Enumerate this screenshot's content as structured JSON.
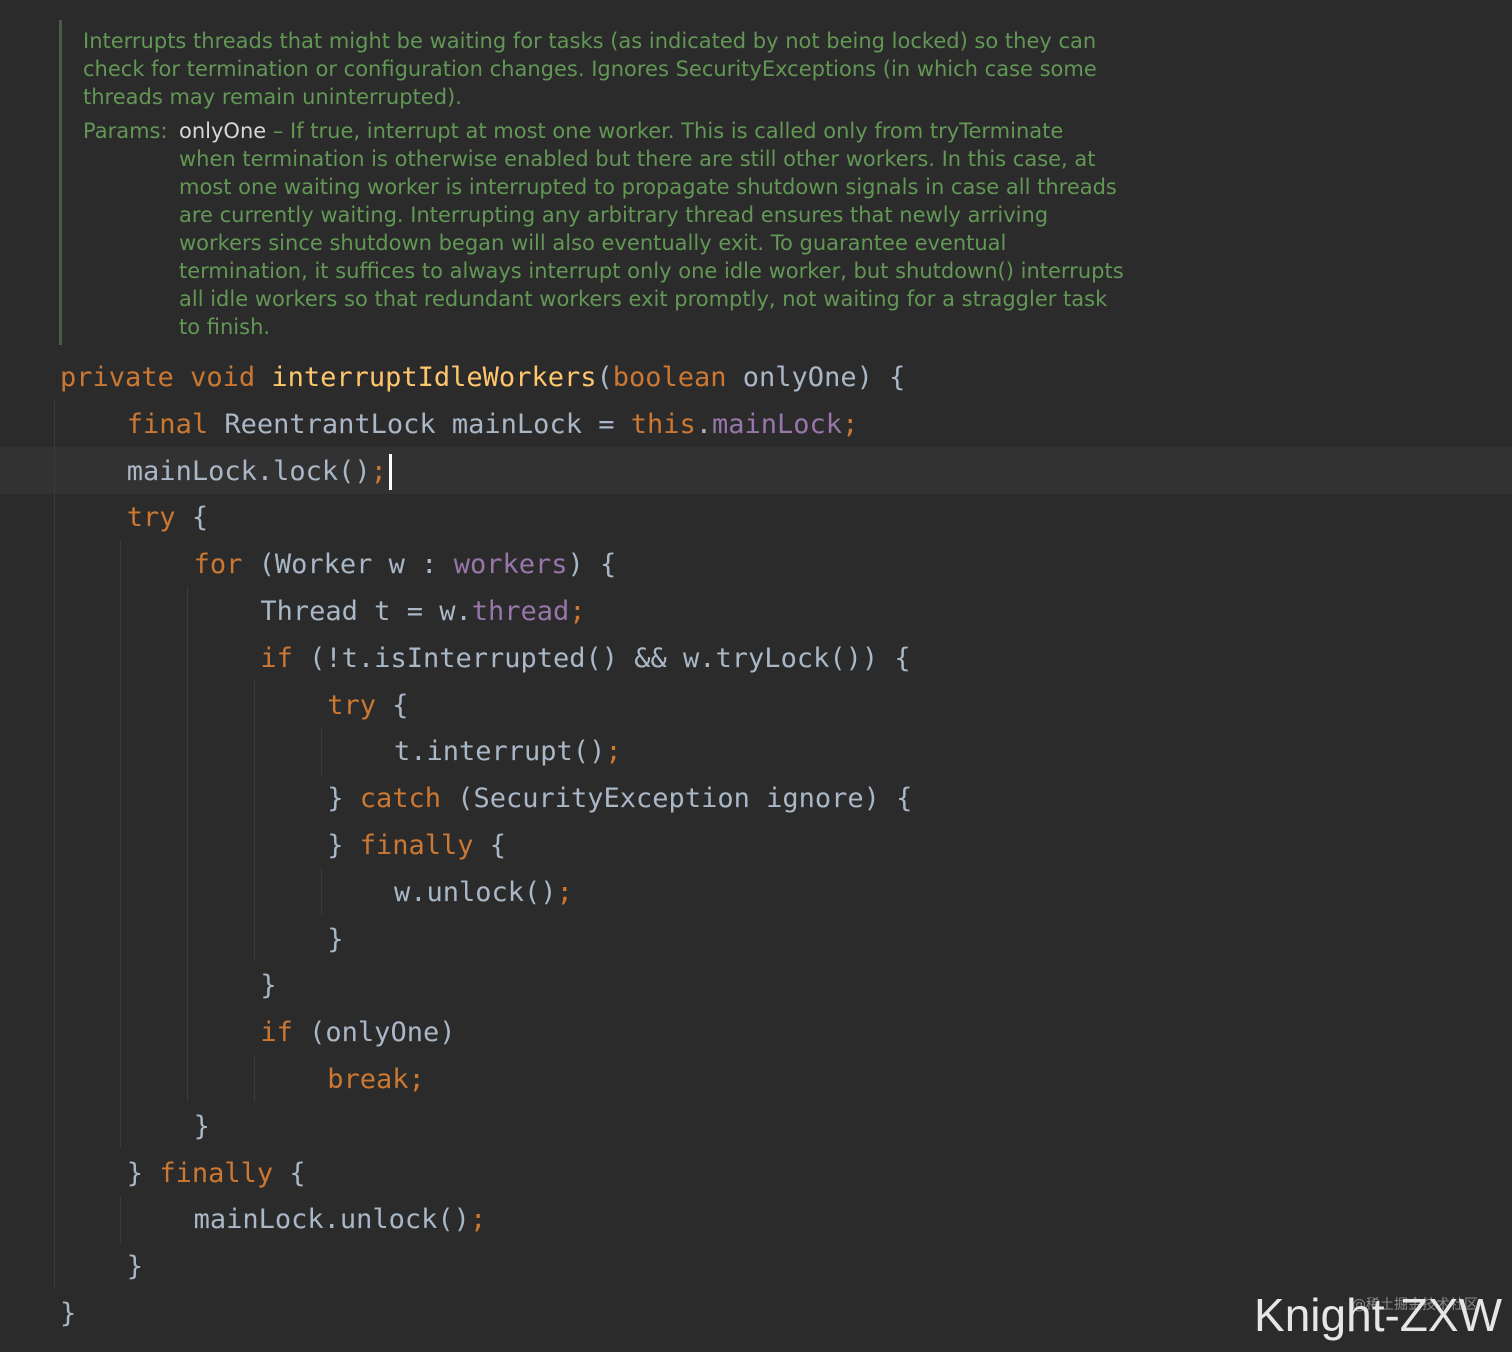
{
  "javadoc": {
    "summary": [
      "Interrupts threads that might be waiting for tasks (as indicated by not being locked) so they can",
      "check for termination or configuration changes. Ignores SecurityExceptions (in which case some",
      "threads may remain uninterrupted)."
    ],
    "params_label": "Params:",
    "param_name": "onlyOne",
    "param_desc": [
      " – If true, interrupt at most one worker. This is called only from tryTerminate",
      "when termination is otherwise enabled but there are still other workers. In this case, at",
      "most one waiting worker is interrupted to propagate shutdown signals in case all threads",
      "are currently waiting. Interrupting any arbitrary thread ensures that newly arriving",
      "workers since shutdown began will also eventually exit. To guarantee eventual",
      "termination, it suffices to always interrupt only one idle worker, but shutdown() interrupts",
      "all idle workers so that redundant workers exit promptly, not waiting for a straggler task",
      "to finish."
    ]
  },
  "code": [
    {
      "indent": 0,
      "tokens": [
        [
          "kw",
          "private"
        ],
        [
          "",
          " "
        ],
        [
          "kw",
          "void"
        ],
        [
          "",
          " "
        ],
        [
          "fn",
          "interruptIdleWorkers"
        ],
        [
          "",
          "("
        ],
        [
          "kw",
          "boolean"
        ],
        [
          "",
          " onlyOne) {"
        ]
      ]
    },
    {
      "indent": 1,
      "tokens": [
        [
          "kw",
          "final"
        ],
        [
          "",
          " ReentrantLock mainLock = "
        ],
        [
          "kw",
          "this"
        ],
        [
          "",
          "."
        ],
        [
          "fld",
          "mainLock"
        ],
        [
          "kw",
          ";"
        ]
      ]
    },
    {
      "indent": 1,
      "tokens": [
        [
          "",
          "mainLock.lock()"
        ],
        [
          "kw",
          ";"
        ]
      ],
      "caret": true
    },
    {
      "indent": 1,
      "tokens": [
        [
          "kw",
          "try"
        ],
        [
          "",
          " {"
        ]
      ]
    },
    {
      "indent": 2,
      "tokens": [
        [
          "kw",
          "for"
        ],
        [
          "",
          " (Worker w : "
        ],
        [
          "fld",
          "workers"
        ],
        [
          "",
          ") {"
        ]
      ]
    },
    {
      "indent": 3,
      "tokens": [
        [
          "",
          "Thread t = w."
        ],
        [
          "fld",
          "thread"
        ],
        [
          "kw",
          ";"
        ]
      ]
    },
    {
      "indent": 3,
      "tokens": [
        [
          "kw",
          "if"
        ],
        [
          "",
          " (!t.isInterrupted() && w.tryLock()) {"
        ]
      ]
    },
    {
      "indent": 4,
      "tokens": [
        [
          "kw",
          "try"
        ],
        [
          "",
          " {"
        ]
      ]
    },
    {
      "indent": 5,
      "tokens": [
        [
          "",
          "t.interrupt()"
        ],
        [
          "kw",
          ";"
        ]
      ]
    },
    {
      "indent": 4,
      "tokens": [
        [
          "",
          "} "
        ],
        [
          "kw",
          "catch"
        ],
        [
          "",
          " (SecurityException ignore) {"
        ]
      ]
    },
    {
      "indent": 4,
      "tokens": [
        [
          "",
          "} "
        ],
        [
          "kw",
          "finally"
        ],
        [
          "",
          " {"
        ]
      ]
    },
    {
      "indent": 5,
      "tokens": [
        [
          "",
          "w.unlock()"
        ],
        [
          "kw",
          ";"
        ]
      ]
    },
    {
      "indent": 4,
      "tokens": [
        [
          "",
          "}"
        ]
      ]
    },
    {
      "indent": 3,
      "tokens": [
        [
          "",
          "}"
        ]
      ]
    },
    {
      "indent": 3,
      "tokens": [
        [
          "kw",
          "if"
        ],
        [
          "",
          " (onlyOne)"
        ]
      ]
    },
    {
      "indent": 4,
      "tokens": [
        [
          "kw",
          "break;"
        ]
      ]
    },
    {
      "indent": 2,
      "tokens": [
        [
          "",
          "}"
        ]
      ]
    },
    {
      "indent": 1,
      "tokens": [
        [
          "",
          "} "
        ],
        [
          "kw",
          "finally"
        ],
        [
          "",
          " {"
        ]
      ]
    },
    {
      "indent": 2,
      "tokens": [
        [
          "",
          "mainLock.unlock()"
        ],
        [
          "kw",
          ";"
        ]
      ]
    },
    {
      "indent": 1,
      "tokens": [
        [
          "",
          "}"
        ]
      ]
    },
    {
      "indent": 0,
      "tokens": [
        [
          "",
          "}"
        ]
      ]
    }
  ],
  "watermark": {
    "text": "Knight-ZXW",
    "small_text": "@稀土掘金技术社区"
  },
  "colors": {
    "background": "#2b2b2b",
    "keyword": "#cc7832",
    "method": "#ffc66d",
    "field": "#9876aa",
    "text": "#a9b7c6",
    "javadoc": "#629755"
  }
}
